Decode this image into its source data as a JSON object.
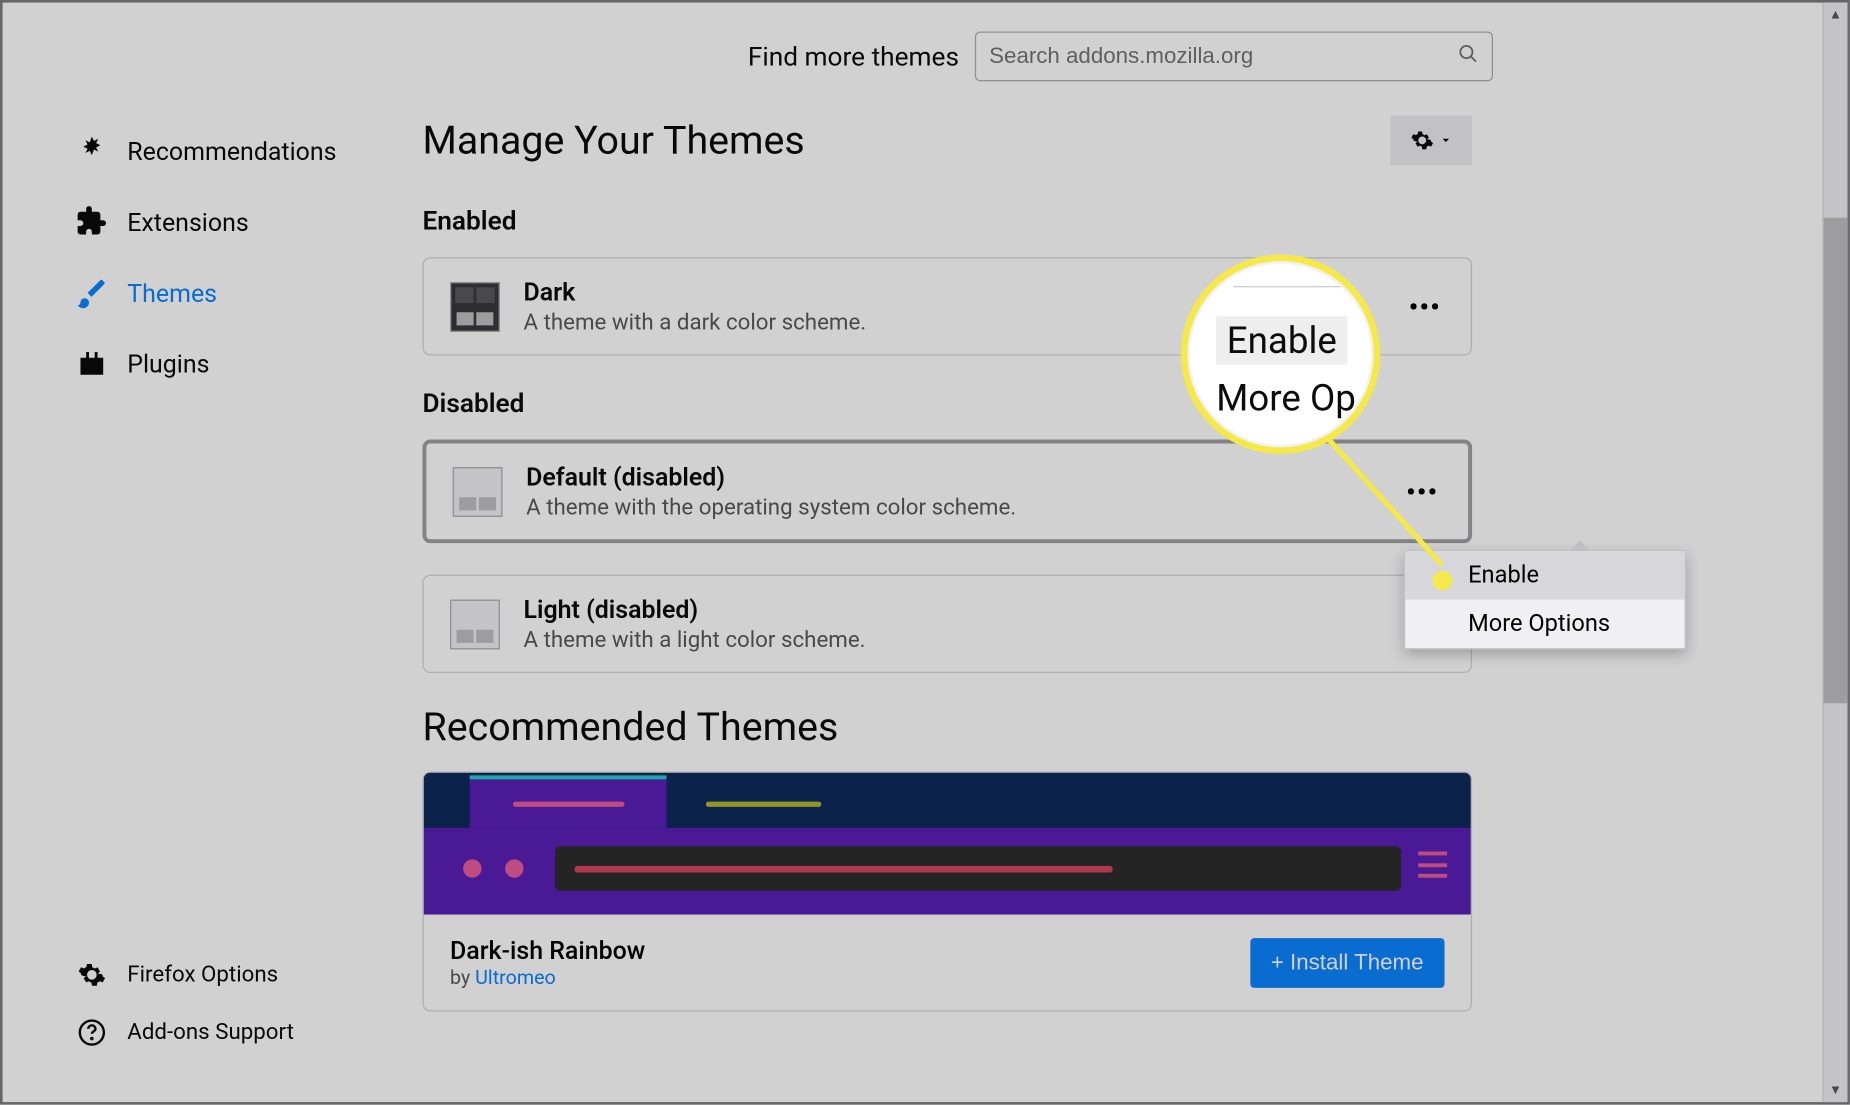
{
  "search": {
    "label": "Find more themes",
    "placeholder": "Search addons.mozilla.org"
  },
  "sidebar": {
    "recommendations": "Recommendations",
    "extensions": "Extensions",
    "themes": "Themes",
    "plugins": "Plugins",
    "firefox_options": "Firefox Options",
    "addons_support": "Add-ons Support"
  },
  "page_title": "Manage Your Themes",
  "sections": {
    "enabled": "Enabled",
    "disabled": "Disabled"
  },
  "themes": {
    "dark": {
      "name": "Dark",
      "desc": "A theme with a dark color scheme."
    },
    "default": {
      "name": "Default (disabled)",
      "desc": "A theme with the operating system color scheme."
    },
    "light": {
      "name": "Light (disabled)",
      "desc": "A theme with a light color scheme."
    }
  },
  "recommended": {
    "title": "Recommended Themes",
    "item": {
      "name": "Dark-ish Rainbow",
      "by_prefix": "by ",
      "author": "Ultromeo",
      "install": "+ Install Theme"
    }
  },
  "dropdown": {
    "enable": "Enable",
    "more_options": "More Options"
  },
  "magnifier": {
    "enable": "Enable",
    "more": "More Op"
  }
}
